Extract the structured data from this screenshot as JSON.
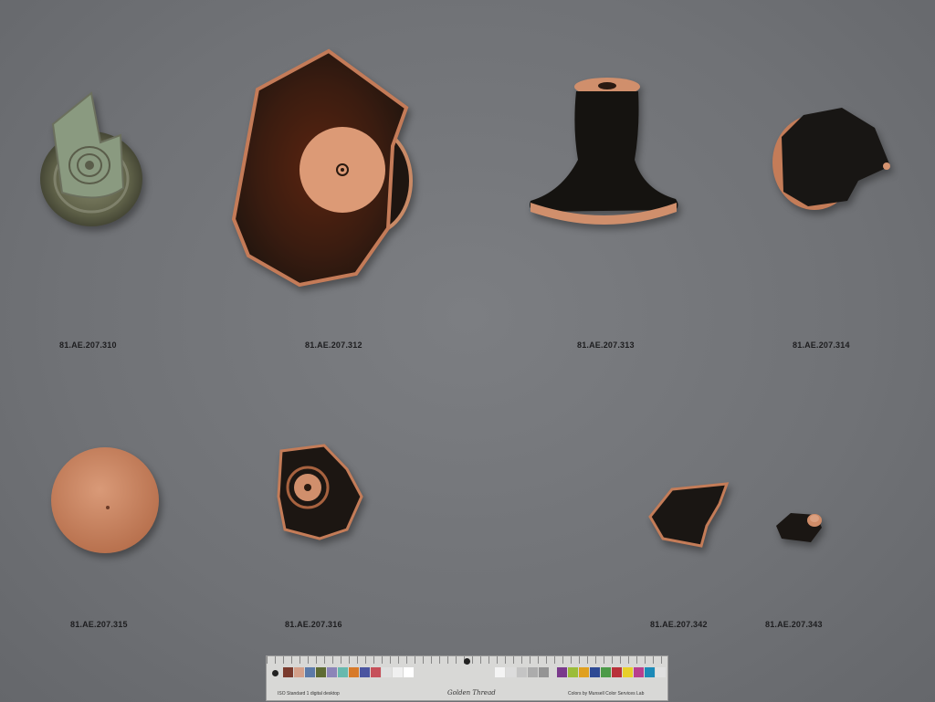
{
  "labels": {
    "l310": "81.AE.207.310",
    "l312": "81.AE.207.312",
    "l313": "81.AE.207.313",
    "l314": "81.AE.207.314",
    "l315": "81.AE.207.315",
    "l316": "81.AE.207.316",
    "l342": "81.AE.207.342",
    "l343": "81.AE.207.343"
  },
  "card": {
    "brand": "Golden Thread",
    "left_note": "ISO Standard 1 digital desktop",
    "right_note": "Colors by Munsell Color Services Lab",
    "patch_colors": [
      "#7a3b2e",
      "#d4a08a",
      "#5c7aa8",
      "#5e6b34",
      "#8c85b8",
      "#68b9ae",
      "#d77a2a",
      "#4b55a0",
      "#c6505a",
      "#e0e0e0",
      "#f0f0f0",
      "#ffffff"
    ],
    "gray_colors": [
      "#f4f4f4",
      "#dcdcdc",
      "#c4c4c4",
      "#acacac",
      "#949494",
      "#7c7c7c",
      "#646464",
      "#4c4c4c",
      "#343434",
      "#1c1c1c"
    ],
    "patch_colors2": [
      "#7a3b8c",
      "#9bbd3a",
      "#e0a020",
      "#2e4a94",
      "#4c9a48",
      "#b8323a",
      "#e8d02a",
      "#b8408e",
      "#1c8ab8",
      "#e0e0e0"
    ]
  }
}
